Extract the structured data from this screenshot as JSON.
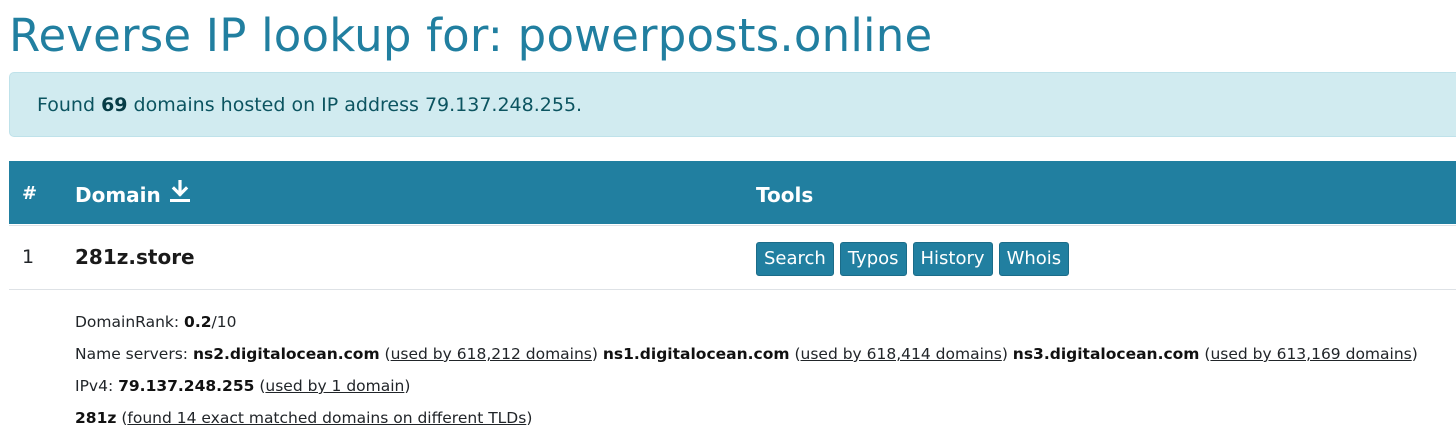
{
  "page": {
    "title": "Reverse IP lookup for: powerposts.online"
  },
  "alert": {
    "prefix": "Found ",
    "count": "69",
    "suffix": " domains hosted on IP address 79.137.248.255."
  },
  "table": {
    "headers": {
      "num": "#",
      "domain": "Domain",
      "tools": "Tools"
    },
    "rows": [
      {
        "num": "1",
        "domain": "281z.store",
        "tools": [
          "Search",
          "Typos",
          "History",
          "Whois"
        ],
        "details": {
          "rank_label": "DomainRank: ",
          "rank_value": "0.2",
          "rank_suffix": "/10",
          "ns_label": "Name servers: ",
          "nameservers": [
            {
              "name": "ns2.digitalocean.com",
              "usage": "used by 618,212 domains"
            },
            {
              "name": "ns1.digitalocean.com",
              "usage": "used by 618,414 domains"
            },
            {
              "name": "ns3.digitalocean.com",
              "usage": "used by 613,169 domains"
            }
          ],
          "ipv4_label": "IPv4: ",
          "ipv4_value": "79.137.248.255",
          "ipv4_usage": "used by 1 domain",
          "keyword": "281z",
          "keyword_link": "found 14 exact matched domains on different TLDs"
        }
      }
    ]
  },
  "colors": {
    "primary": "#217fa0",
    "alert_bg": "#d1ebf0",
    "alert_text": "#0c5460"
  },
  "icons": {
    "download": "download-icon"
  }
}
